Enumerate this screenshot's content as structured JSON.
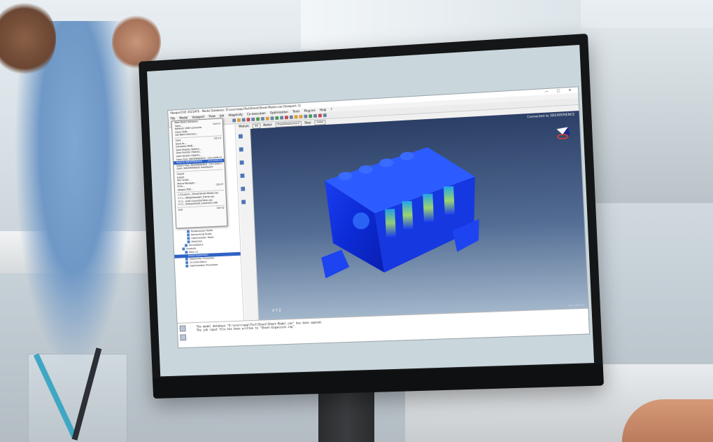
{
  "app": {
    "title": "Abaqus/CAE 2021HF6 - Model Database: D:\\users\\wpp\\Test\\Sheet\\Sheet-Model.cae [Viewport: 1]",
    "window_controls": "— ▢ ✕",
    "menus": [
      "File",
      "Model",
      "Viewport",
      "View",
      "Job",
      "Adaptivity",
      "Co-execution",
      "Optimization",
      "Tools",
      "Plug-ins",
      "Help",
      "?"
    ]
  },
  "model_bar": {
    "module_label": "Module:",
    "module_value": "Job",
    "model_label": "Model:",
    "model_value": "SheetDeployment",
    "step_label": "Step:",
    "step_value": "Initial"
  },
  "file_menu": {
    "items": [
      {
        "label": "New Model Database",
        "shortcut": ""
      },
      {
        "label": "Open...",
        "shortcut": "Ctrl+O"
      },
      {
        "label": "Network ODB Connector",
        "shortcut": ""
      },
      {
        "label": "Close ODB...",
        "shortcut": ""
      },
      {
        "label": "Set Work Directory...",
        "shortcut": ""
      },
      {
        "label": "Save",
        "shortcut": "Ctrl+S"
      },
      {
        "label": "Save As...",
        "shortcut": ""
      },
      {
        "label": "Compress MDB...",
        "shortcut": ""
      },
      {
        "label": "Save Display Options...",
        "shortcut": ""
      },
      {
        "label": "Save Session Objects...",
        "shortcut": ""
      },
      {
        "label": "Load Session Objects...",
        "shortcut": ""
      },
      {
        "label": "Open from 3DEXPERIENCE",
        "shortcut": "Ctrl+Shift+O"
      },
      {
        "label": "Save to 3DEXPERIENCE",
        "shortcut": "Ctrl+Shift+S"
      },
      {
        "label": "Import from 3DEXPERIENCE",
        "shortcut": "Ctrl+Shift+I"
      },
      {
        "label": "Open 3DEXPERIENCE Dashboard",
        "shortcut": ""
      },
      {
        "label": "Import",
        "shortcut": ""
      },
      {
        "label": "Export",
        "shortcut": ""
      },
      {
        "label": "Run Script...",
        "shortcut": ""
      },
      {
        "label": "Macro Manager...",
        "shortcut": ""
      },
      {
        "label": "Print...",
        "shortcut": "Ctrl+P"
      },
      {
        "label": "Abaqus PDE...",
        "shortcut": ""
      },
      {
        "label": "1 D:\\users\\...\\Sheet\\Sheet-Model.cae",
        "shortcut": ""
      },
      {
        "label": "2 C:\\...\\Weight\\weight_frame.cae",
        "shortcut": ""
      },
      {
        "label": "3 C:\\...\\CAE-Connector\\test.cae",
        "shortcut": ""
      },
      {
        "label": "4 C:\\...\\Heaps\\Sheet_expansion.odb",
        "shortcut": ""
      },
      {
        "label": "Exit",
        "shortcut": "Ctrl+Q"
      }
    ],
    "highlighted_index": 12
  },
  "tree": {
    "items": [
      "Postprocess Fields",
      "Remeshing Rules",
      "Optimization Tasks",
      "Sketches",
      "Annotations",
      "Analysis",
      "Jobs (1)",
      "Sheet-Expansion",
      "Adaptivity Processes",
      "Co-executions",
      "Optimization Processes"
    ],
    "selected_index": 7
  },
  "viewport": {
    "connection_label": "Connected to 3DEXPERIENCE",
    "axis_label": "X  Y  Z",
    "brand": "3DS SIMULIA"
  },
  "messages": [
    "The model database \"D:\\users\\wpp\\Test\\Sheet\\Sheet-Model.cae\" has been opened.",
    "The job input file has been written to \"Sheet-Expansion.inp\"."
  ],
  "colors": {
    "highlight": "#2f62c6",
    "viewport_top": "#2c3f66",
    "viewport_bottom": "#a3b7cb",
    "stress_low": "#1030d8",
    "stress_mid": "#24b6e8",
    "stress_high": "#b4f05a"
  }
}
